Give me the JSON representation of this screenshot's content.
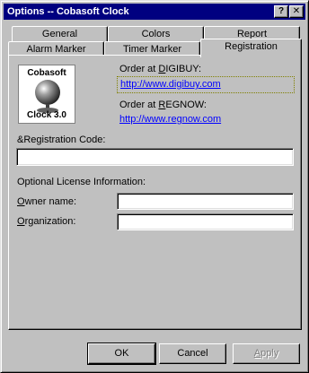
{
  "window": {
    "title": "Options -- Cobasoft Clock",
    "help_glyph": "?",
    "close_glyph": "✕"
  },
  "tabs_back": [
    {
      "label": "General"
    },
    {
      "label": "Colors"
    },
    {
      "label": "Report"
    }
  ],
  "tabs_front": [
    {
      "label": "Alarm Marker"
    },
    {
      "label": "Timer Marker"
    },
    {
      "label": "Registration"
    }
  ],
  "logo": {
    "line1": "Cobasoft",
    "line2": "Clock 3.0"
  },
  "order": {
    "digibuy_label_pre": "Order at ",
    "digibuy_label_u": "D",
    "digibuy_label_post": "IGIBUY:",
    "digibuy_url": "http://www.digibuy.com",
    "regnow_label_pre": "Order at ",
    "regnow_label_u": "R",
    "regnow_label_post": "EGNOW:",
    "regnow_url": "http://www.regnow.com"
  },
  "registration": {
    "code_label": "&Registration Code:",
    "code_value": ""
  },
  "license": {
    "heading": "Optional License Information:",
    "owner_label_u": "O",
    "owner_label_post": "wner name:",
    "owner_value": "",
    "org_label_u": "O",
    "org_label_post": "rganization:",
    "org_value": ""
  },
  "buttons": {
    "ok": "OK",
    "cancel": "Cancel",
    "apply_u": "A",
    "apply_post": "pply"
  },
  "colors": {
    "titlebar": "#000080",
    "link": "#0000ff",
    "face": "#c0c0c0"
  }
}
